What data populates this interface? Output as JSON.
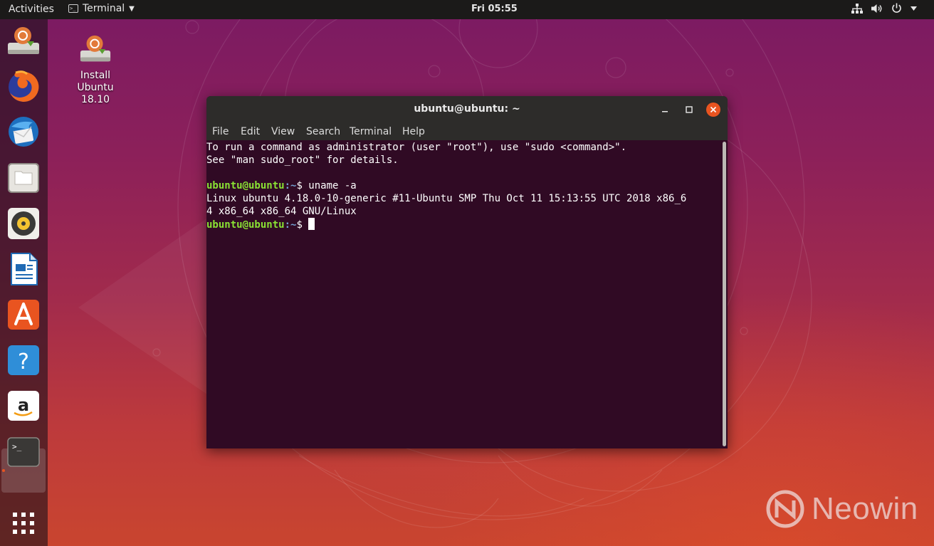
{
  "topbar": {
    "activities": "Activities",
    "app_name": "Terminal",
    "app_icon": "terminal-icon",
    "clock": "Fri 05:55",
    "indicators": [
      "network-icon",
      "volume-icon",
      "power-icon"
    ]
  },
  "dock": {
    "items": [
      {
        "name": "install-ubuntu",
        "icon": "installer-icon"
      },
      {
        "name": "firefox",
        "icon": "firefox-icon"
      },
      {
        "name": "thunderbird",
        "icon": "thunderbird-icon"
      },
      {
        "name": "files",
        "icon": "files-icon"
      },
      {
        "name": "rhythmbox",
        "icon": "rhythmbox-icon"
      },
      {
        "name": "libreoffice-writer",
        "icon": "writer-icon"
      },
      {
        "name": "ubuntu-software",
        "icon": "software-icon"
      },
      {
        "name": "help",
        "icon": "help-icon"
      },
      {
        "name": "amazon",
        "icon": "amazon-icon"
      },
      {
        "name": "terminal",
        "icon": "terminal-icon",
        "running": true
      },
      {
        "name": "show-applications",
        "icon": "app-grid-icon"
      }
    ]
  },
  "desktop": {
    "install_label": "Install\nUbuntu\n18.10"
  },
  "window": {
    "title": "ubuntu@ubuntu: ~",
    "menu": [
      "File",
      "Edit",
      "View",
      "Search",
      "Terminal",
      "Help"
    ],
    "terminal": {
      "line1": "To run a command as administrator (user \"root\"), use \"sudo <command>\".",
      "line2": "See \"man sudo_root\" for details.",
      "prompt_user": "ubuntu@ubuntu",
      "prompt_path": ":~",
      "prompt_symbol": "$ ",
      "command": "uname -a",
      "output1": "Linux ubuntu 4.18.0-10-generic #11-Ubuntu SMP Thu Oct 11 15:13:55 UTC 2018 x86_6",
      "output2": "4 x86_64 x86_64 GNU/Linux"
    }
  },
  "watermark": {
    "text": "Neowin"
  },
  "colors": {
    "ubuntu_orange": "#e95420",
    "terminal_bg": "#300a24",
    "prompt_user": "#8ae234",
    "prompt_path": "#729fcf"
  }
}
